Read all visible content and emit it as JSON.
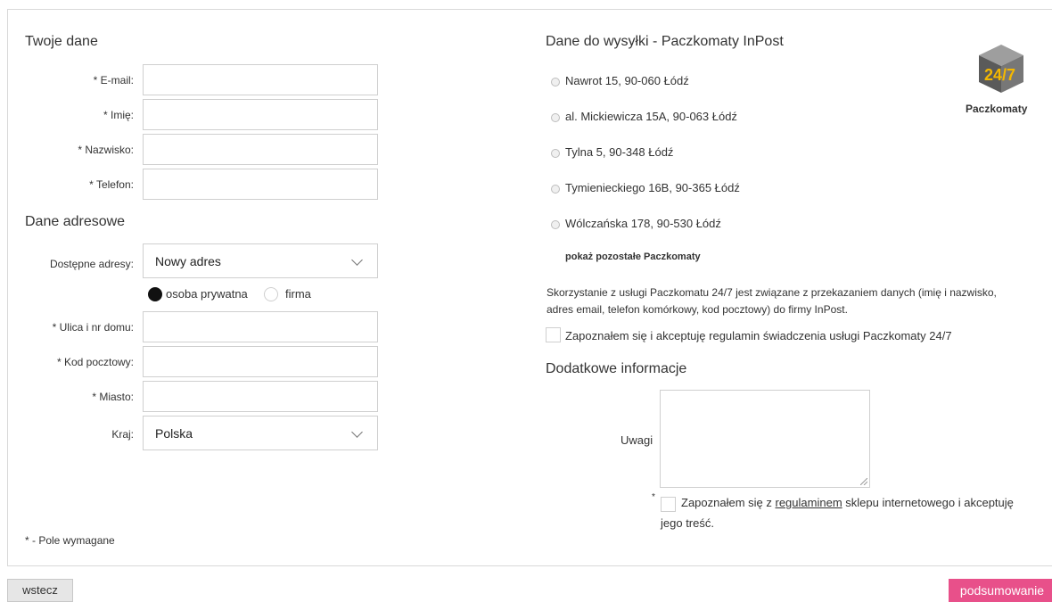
{
  "left": {
    "title": "Twoje dane",
    "fields": {
      "email": "* E-mail:",
      "first_name": "* Imię:",
      "last_name": "* Nazwisko:",
      "phone": "* Telefon:"
    },
    "address_title": "Dane adresowe",
    "available_label": "Dostępne adresy:",
    "available_value": "Nowy adres",
    "person_type": {
      "private": "osoba prywatna",
      "company": "firma"
    },
    "street": "* Ulica i nr domu:",
    "postcode": "* Kod pocztowy:",
    "city": "* Miasto:",
    "country_label": "Kraj:",
    "country_value": "Polska",
    "required_note": "* - Pole wymagane"
  },
  "right": {
    "title": "Dane do wysyłki - Paczkomaty InPost",
    "lockers": [
      "Nawrot 15, 90-060 Łódź",
      "al. Mickiewicza 15A, 90-063 Łódź",
      "Tylna 5, 90-348 Łódź",
      "Tymienieckiego 16B, 90-365 Łódź",
      "Wólczańska 178, 90-530 Łódź"
    ],
    "show_more": "pokaż pozostałe Paczkomaty",
    "logo_badge": "24/7",
    "logo_text": "Paczkomaty",
    "notice_line1": "Skorzystanie z usługi Paczkomatu 24/7 jest związane z przekazaniem danych (imię i nazwisko,",
    "notice_line2": "adres email, telefon komórkowy, kod pocztowy) do firmy InPost.",
    "accept_inpost": "Zapoznałem się i akceptuję regulamin świadczenia usługi Paczkomaty 24/7",
    "extra_title": "Dodatkowe informacje",
    "notes_label": "Uwagi",
    "terms_star": "*",
    "terms_before": "Zapoznałem się z ",
    "terms_link": "regulaminem",
    "terms_after": " sklepu internetowego i akceptuję",
    "terms_line2": "jego treść."
  },
  "buttons": {
    "back": "wstecz",
    "next": "podsumowanie"
  },
  "colors": {
    "accent": "#e8508a"
  }
}
